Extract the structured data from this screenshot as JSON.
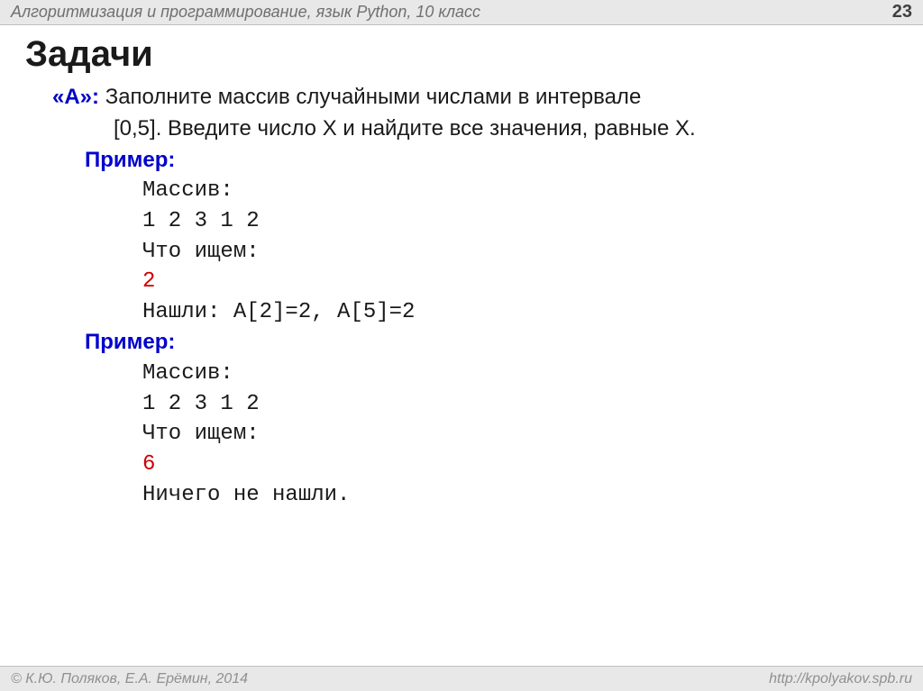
{
  "header": {
    "title": "Алгоритмизация и программирование, язык Python, 10 класс",
    "pageNumber": "23"
  },
  "mainTitle": "Задачи",
  "task": {
    "label": "«A»:",
    "line1": " Заполните массив случайными числами в интервале",
    "line2": "[0,5]. Введите число X и найдите все значения, равные X."
  },
  "example1": {
    "label": "Пример:",
    "arrayLabel": "Массив:",
    "arrayValues": "1 2 3 1 2",
    "searchLabel": "Что ищем:",
    "searchValue": "2",
    "result": "Нашли: A[2]=2, A[5]=2"
  },
  "example2": {
    "label": "Пример:",
    "arrayLabel": "Массив:",
    "arrayValues": "1 2 3 1 2",
    "searchLabel": "Что ищем:",
    "searchValue": "6",
    "result": "Ничего не нашли."
  },
  "footer": {
    "left": "© К.Ю. Поляков, Е.А. Ерёмин, 2014",
    "right": "http://kpolyakov.spb.ru"
  }
}
